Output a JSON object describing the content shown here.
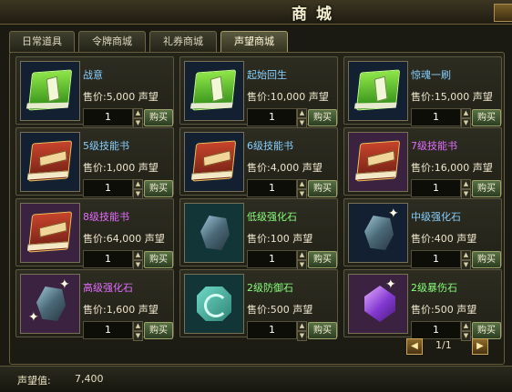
{
  "window": {
    "title": "商城"
  },
  "tabs": [
    {
      "label": "日常道具"
    },
    {
      "label": "令牌商城"
    },
    {
      "label": "礼券商城"
    },
    {
      "label": "声望商城"
    }
  ],
  "active_tab": "声望商城",
  "price_prefix": "售价:",
  "currency_unit": "声望",
  "buy_label": "购买",
  "stepper_up": "▲",
  "stepper_down": "▼",
  "items": [
    {
      "name": "战意",
      "price": "5,000",
      "qty": "1",
      "icon": "green-book-icon",
      "name_color": "#86cfff"
    },
    {
      "name": "起始回生",
      "price": "10,000",
      "qty": "1",
      "icon": "green-book-icon",
      "name_color": "#86cfff"
    },
    {
      "name": "惊魂一刷",
      "price": "15,000",
      "qty": "1",
      "icon": "green-book-icon",
      "name_color": "#86cfff"
    },
    {
      "name": "5级技能书",
      "price": "1,000",
      "qty": "1",
      "icon": "skill-book-icon",
      "name_color": "#86cfff"
    },
    {
      "name": "6级技能书",
      "price": "4,000",
      "qty": "1",
      "icon": "skill-book-icon",
      "name_color": "#86cfff"
    },
    {
      "name": "7级技能书",
      "price": "16,000",
      "qty": "1",
      "icon": "skill-book-icon",
      "name_color": "#e46cff"
    },
    {
      "name": "8级技能书",
      "price": "64,000",
      "qty": "1",
      "icon": "skill-book-icon",
      "name_color": "#e46cff"
    },
    {
      "name": "低级强化石",
      "price": "100",
      "qty": "1",
      "icon": "enhance-stone-icon",
      "name_color": "#86ff7a"
    },
    {
      "name": "中级强化石",
      "price": "400",
      "qty": "1",
      "icon": "enhance-stone-icon",
      "name_color": "#86cfff"
    },
    {
      "name": "高级强化石",
      "price": "1,600",
      "qty": "1",
      "icon": "enhance-stone-icon",
      "name_color": "#e46cff"
    },
    {
      "name": "2级防御石",
      "price": "500",
      "qty": "1",
      "icon": "defense-stone-icon",
      "name_color": "#86ff7a"
    },
    {
      "name": "2级暴伤石",
      "price": "500",
      "qty": "1",
      "icon": "crit-gem-icon",
      "name_color": "#86ff7a"
    }
  ],
  "pager": {
    "text": "1/1",
    "prev": "◀",
    "next": "▶"
  },
  "footer": {
    "fame_label": "声望值:",
    "fame_value": "7,400"
  },
  "colors": {
    "blue_name": "#86cfff",
    "purple_name": "#e46cff",
    "green_name": "#86ff7a",
    "accent_gold": "#caa55f"
  }
}
